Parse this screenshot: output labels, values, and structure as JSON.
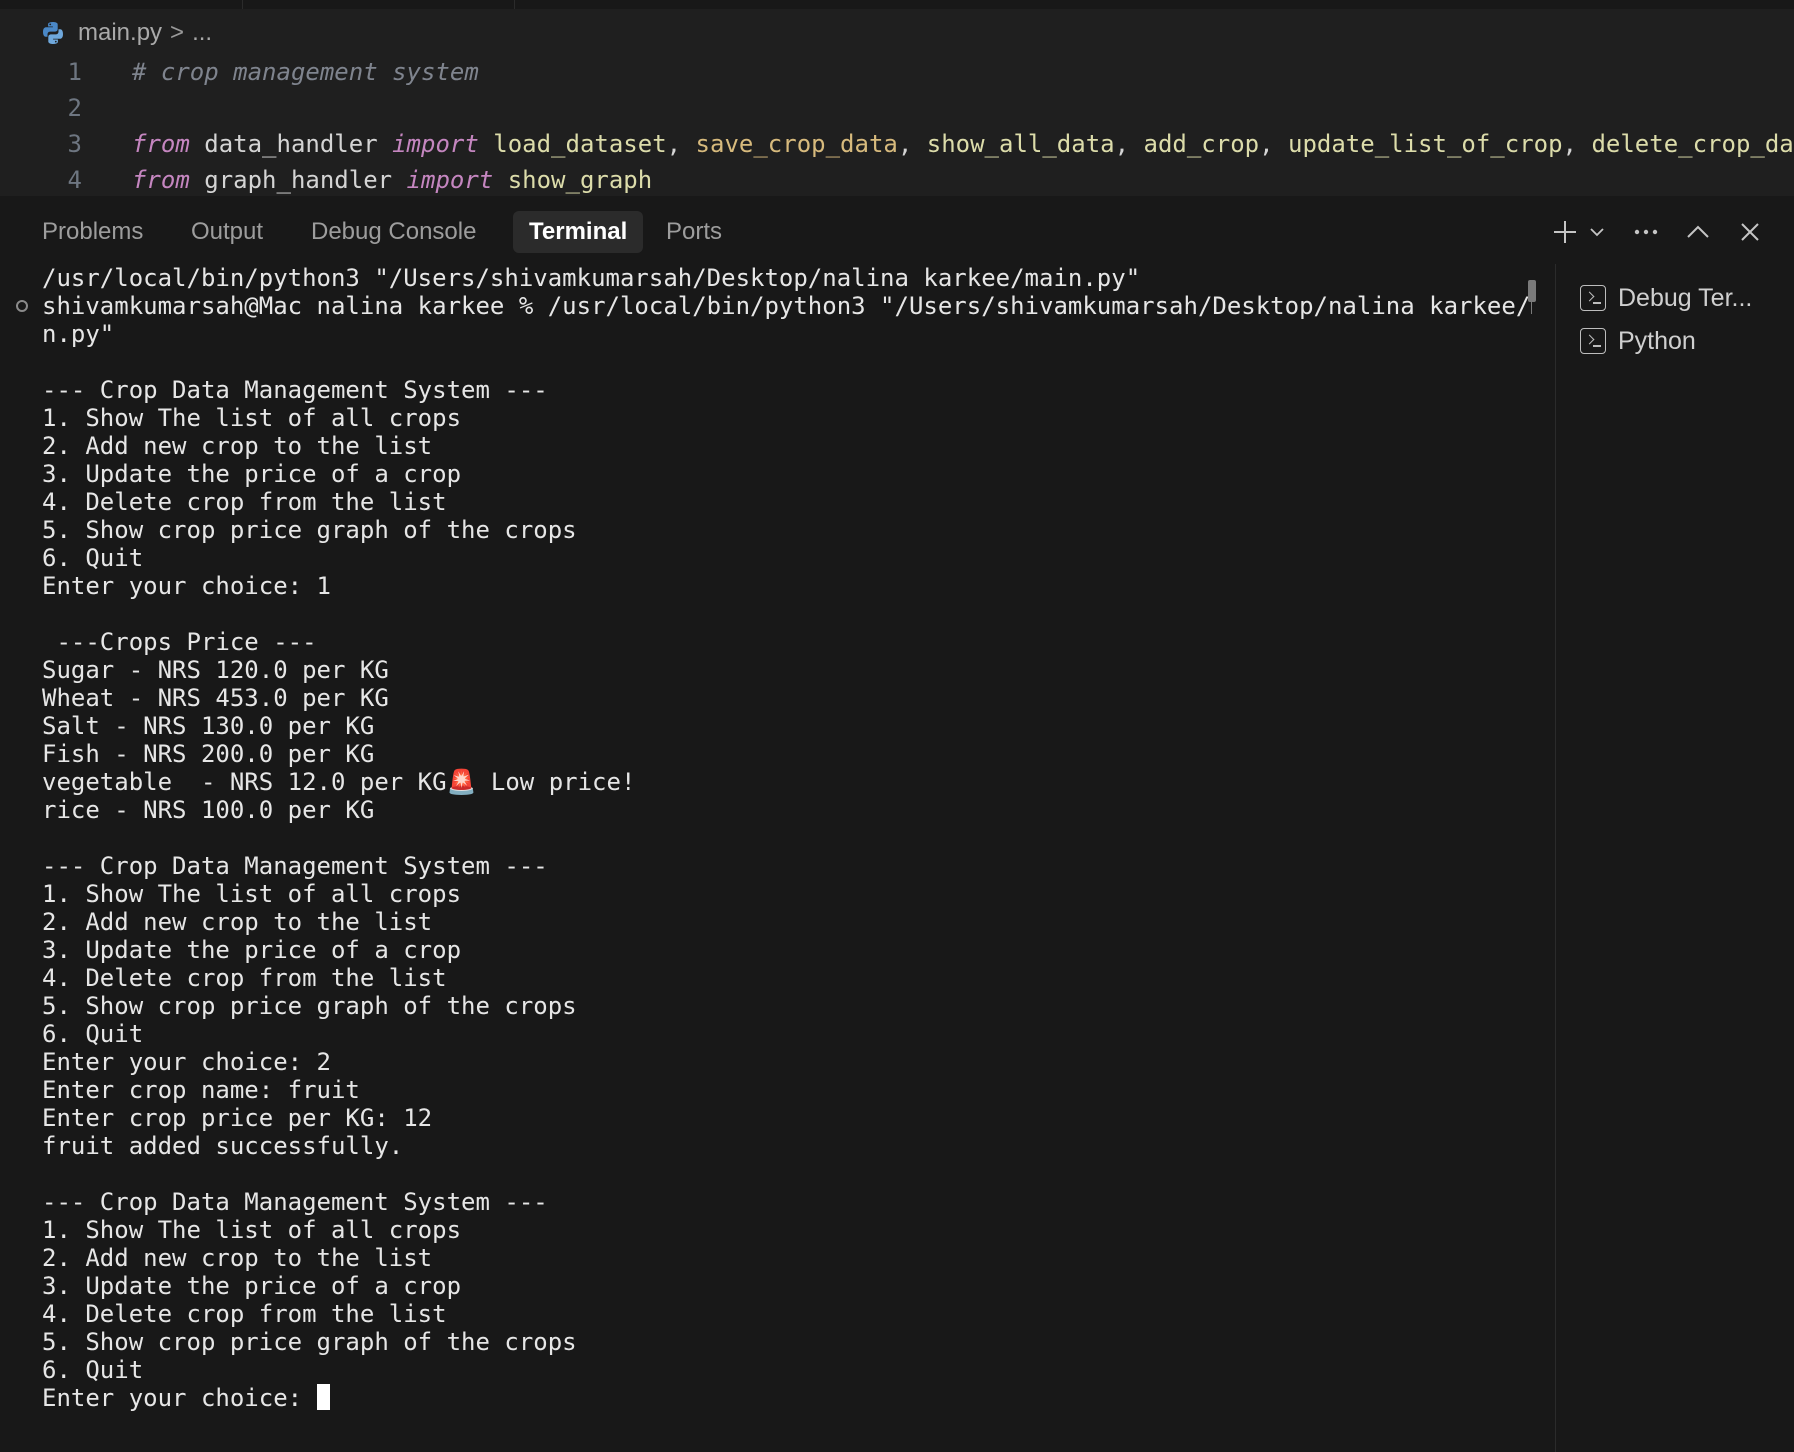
{
  "breadcrumb": {
    "file": "main.py",
    "separator": ">",
    "rest": "..."
  },
  "editor": {
    "lines": [
      {
        "n": "1",
        "tokens": [
          {
            "t": "# crop management system",
            "k": "comment"
          }
        ]
      },
      {
        "n": "2",
        "tokens": []
      },
      {
        "n": "3",
        "tokens": [
          {
            "t": "from",
            "k": "kw"
          },
          {
            "t": " data_handler ",
            "k": "plain"
          },
          {
            "t": "import",
            "k": "kw"
          },
          {
            "t": " ",
            "k": "plain"
          },
          {
            "t": "load_dataset",
            "k": "fn"
          },
          {
            "t": ", ",
            "k": "punct"
          },
          {
            "t": "save_crop_data",
            "k": "fn2"
          },
          {
            "t": ", ",
            "k": "punct"
          },
          {
            "t": "show_all_data",
            "k": "fn"
          },
          {
            "t": ", ",
            "k": "punct"
          },
          {
            "t": "add_crop",
            "k": "fn"
          },
          {
            "t": ", ",
            "k": "punct"
          },
          {
            "t": "update_list_of_crop",
            "k": "fn"
          },
          {
            "t": ", ",
            "k": "punct"
          },
          {
            "t": "delete_crop_da",
            "k": "fn"
          }
        ]
      },
      {
        "n": "4",
        "tokens": [
          {
            "t": "from",
            "k": "kw"
          },
          {
            "t": " graph_handler ",
            "k": "plain"
          },
          {
            "t": "import",
            "k": "kw"
          },
          {
            "t": " ",
            "k": "plain"
          },
          {
            "t": "show_graph",
            "k": "fn"
          }
        ]
      }
    ]
  },
  "panel": {
    "tabs": [
      "Problems",
      "Output",
      "Debug Console",
      "Terminal",
      "Ports"
    ],
    "active_tab": "Terminal",
    "actions": [
      "plus-icon",
      "chevron-down-icon",
      "more-icon",
      "chevron-up-icon",
      "close-icon"
    ]
  },
  "terminal": {
    "lines": [
      "/usr/local/bin/python3 \"/Users/shivamkumarsah/Desktop/nalina karkee/main.py\"",
      "shivamkumarsah@Mac nalina karkee % /usr/local/bin/python3 \"/Users/shivamkumarsah/Desktop/nalina karkee/mai",
      "n.py\"",
      "",
      "--- Crop Data Management System ---",
      "1. Show The list of all crops",
      "2. Add new crop to the list",
      "3. Update the price of a crop",
      "4. Delete crop from the list",
      "5. Show crop price graph of the crops",
      "6. Quit",
      "Enter your choice: 1",
      "",
      " ---Crops Price ---",
      "Sugar - NRS 120.0 per KG",
      "Wheat - NRS 453.0 per KG",
      "Salt - NRS 130.0 per KG",
      "Fish - NRS 200.0 per KG",
      "vegetable  - NRS 12.0 per KG🚨 Low price!",
      "rice - NRS 100.0 per KG",
      "",
      "--- Crop Data Management System ---",
      "1. Show The list of all crops",
      "2. Add new crop to the list",
      "3. Update the price of a crop",
      "4. Delete crop from the list",
      "5. Show crop price graph of the crops",
      "6. Quit",
      "Enter your choice: 2",
      "Enter crop name: fruit",
      "Enter crop price per KG: 12",
      "fruit added successfully.",
      "",
      "--- Crop Data Management System ---",
      "1. Show The list of all crops",
      "2. Add new crop to the list",
      "3. Update the price of a crop",
      "4. Delete crop from the list",
      "5. Show crop price graph of the crops",
      "6. Quit"
    ],
    "prompt": "Enter your choice: "
  },
  "terminal_list": {
    "items": [
      "Debug Ter...",
      "Python"
    ]
  }
}
